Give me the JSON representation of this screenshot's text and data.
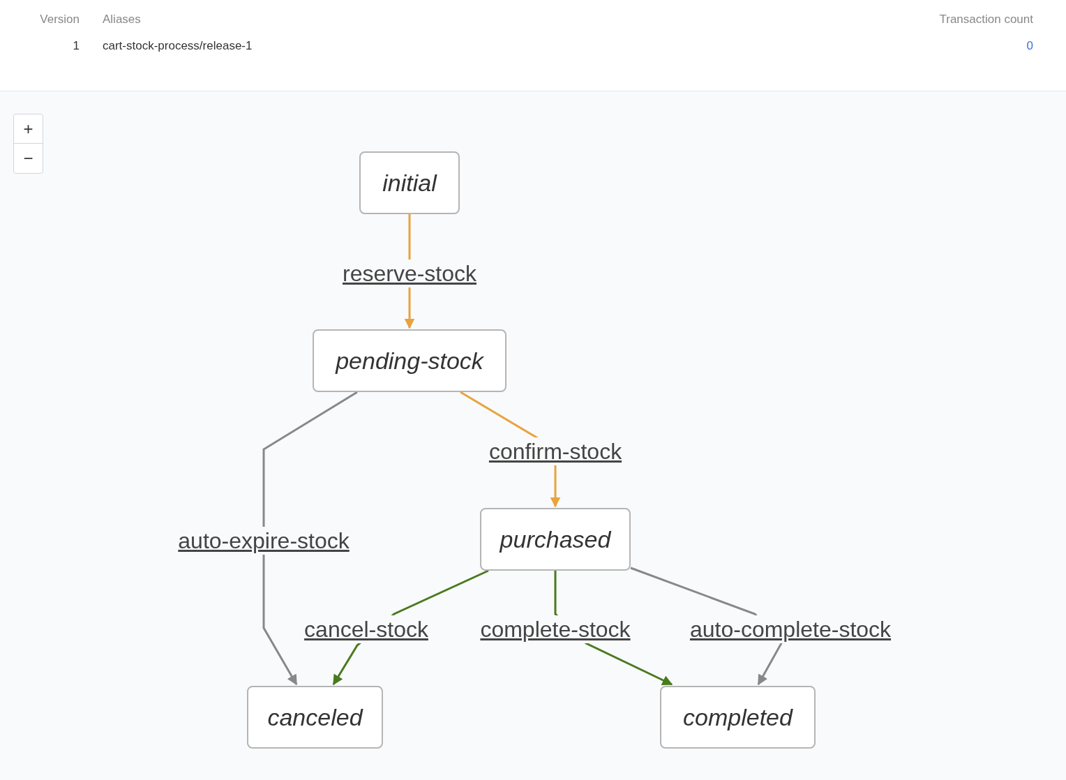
{
  "versions_table": {
    "columns": [
      "Version",
      "Aliases",
      "Transaction count"
    ],
    "rows": [
      {
        "version": "1",
        "alias": "cart-stock-process/release-1",
        "transaction_count": "0"
      }
    ]
  },
  "zoom_controls": [
    "+",
    "−"
  ],
  "diagram": {
    "nodes": [
      {
        "label": "initial"
      },
      {
        "label": "pending-stock"
      },
      {
        "label": "purchased"
      },
      {
        "label": "canceled"
      },
      {
        "label": "completed"
      }
    ],
    "edges": [
      {
        "label": "reserve-stock",
        "color": "#e8a33d"
      },
      {
        "label": "auto-expire-stock",
        "color": "#888888"
      },
      {
        "label": "confirm-stock",
        "color": "#e8a33d"
      },
      {
        "label": "cancel-stock",
        "color": "#4a7a1f"
      },
      {
        "label": "complete-stock",
        "color": "#4a7a1f"
      },
      {
        "label": "auto-complete-stock",
        "color": "#888888"
      }
    ]
  }
}
